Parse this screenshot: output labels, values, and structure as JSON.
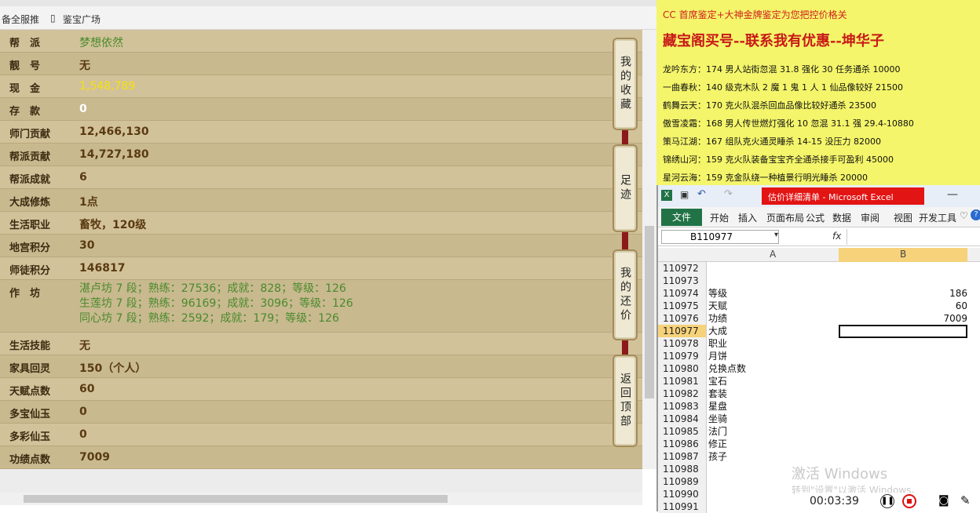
{
  "browser": {
    "bookmark1": "备全服推",
    "bookmark2": "鉴宝广场"
  },
  "rows": [
    {
      "label": "帮　派",
      "value": "梦想依然",
      "style": "green"
    },
    {
      "label": "靓　号",
      "value": "无",
      "style": ""
    },
    {
      "label": "现　金",
      "value": "1,548,789",
      "style": "yellow"
    },
    {
      "label": "存　款",
      "value": "0",
      "style": "white"
    },
    {
      "label": "师门贡献",
      "value": "12,466,130",
      "style": ""
    },
    {
      "label": "帮派贡献",
      "value": "14,727,180",
      "style": ""
    },
    {
      "label": "帮派成就",
      "value": "6",
      "style": ""
    },
    {
      "label": "大成修炼",
      "value": "1点",
      "style": ""
    },
    {
      "label": "生活职业",
      "value": "畜牧，120级",
      "style": ""
    },
    {
      "label": "地宫积分",
      "value": "30",
      "style": ""
    },
    {
      "label": "师徒积分",
      "value": "146817",
      "style": ""
    }
  ],
  "workshop": {
    "label": "作　坊",
    "lines": [
      "湛卢坊 7 段；熟练：27536；成就：828；等级：126",
      "生莲坊 7 段；熟练：96169；成就：3096；等级：126",
      "同心坊 7 段；熟练：2592；成就：179；等级：126"
    ]
  },
  "rows2": [
    {
      "label": "生活技能",
      "value": "无"
    },
    {
      "label": "家具回灵",
      "value": "150（个人）"
    },
    {
      "label": "天赋点数",
      "value": "60"
    },
    {
      "label": "多宝仙玉",
      "value": "0"
    },
    {
      "label": "多彩仙玉",
      "value": "0"
    },
    {
      "label": "功绩点数",
      "value": "7009"
    }
  ],
  "side_buttons": [
    "我的收藏",
    "足迹",
    "我的还价",
    "返回顶部"
  ],
  "ad": {
    "line1": "CC 首席鉴定+大神金牌鉴定为您把控价格关",
    "line2": "藏宝阁买号--联系我有优惠--坤华子",
    "items": [
      "龙吟东方：174 男人站街忽混 31.8 强化 30 任务通杀 10000",
      "一曲春秋：140 级克木队 2 魔 1 鬼 1 人 1 仙品像较好 21500",
      "鹤舞云天：170 克火队混杀回血品像比较好通杀 23500",
      "傲雪凌霜：168 男人传世燃灯强化 10 忽混 31.1 强 29.4-10880",
      "策马江湖：167 组队克火通灵睡杀 14-15 没压力 82000",
      "锦绣山河：159 克火队装备宝宝齐全通杀接手可盈利 45000",
      "星河云海：159 克金队绕一种植景行明光睡杀 20000"
    ]
  },
  "excel": {
    "title": "估价详细清单 - Microsoft Excel",
    "file_tab": "文件",
    "tabs": [
      "开始",
      "插入",
      "页面布局",
      "公式",
      "数据",
      "审阅",
      "视图",
      "开发工具"
    ],
    "name_box": "B110977",
    "fx": "fx",
    "col_a": "A",
    "col_b": "B",
    "rows": [
      {
        "n": "110972",
        "a": "",
        "b": ""
      },
      {
        "n": "110973",
        "a": "",
        "b": ""
      },
      {
        "n": "110974",
        "a": "等级",
        "b": "186"
      },
      {
        "n": "110975",
        "a": "天赋",
        "b": "60"
      },
      {
        "n": "110976",
        "a": "功绩",
        "b": "7009"
      },
      {
        "n": "110977",
        "a": "大成",
        "b": ""
      },
      {
        "n": "110978",
        "a": "职业",
        "b": ""
      },
      {
        "n": "110979",
        "a": "月饼",
        "b": ""
      },
      {
        "n": "110980",
        "a": "兑换点数",
        "b": ""
      },
      {
        "n": "110981",
        "a": "宝石",
        "b": ""
      },
      {
        "n": "110982",
        "a": "套装",
        "b": ""
      },
      {
        "n": "110983",
        "a": "星盘",
        "b": ""
      },
      {
        "n": "110984",
        "a": "坐骑",
        "b": ""
      },
      {
        "n": "110985",
        "a": "法门",
        "b": ""
      },
      {
        "n": "110986",
        "a": "修正",
        "b": ""
      },
      {
        "n": "110987",
        "a": "孩子",
        "b": ""
      },
      {
        "n": "110988",
        "a": "",
        "b": ""
      },
      {
        "n": "110989",
        "a": "",
        "b": ""
      },
      {
        "n": "110990",
        "a": "",
        "b": ""
      },
      {
        "n": "110991",
        "a": "",
        "b": ""
      }
    ]
  },
  "watermark": {
    "line1": "激活 Windows",
    "line2": "转到\"设置\"以激活 Windows。"
  },
  "recorder": {
    "time": "00:03:39"
  }
}
